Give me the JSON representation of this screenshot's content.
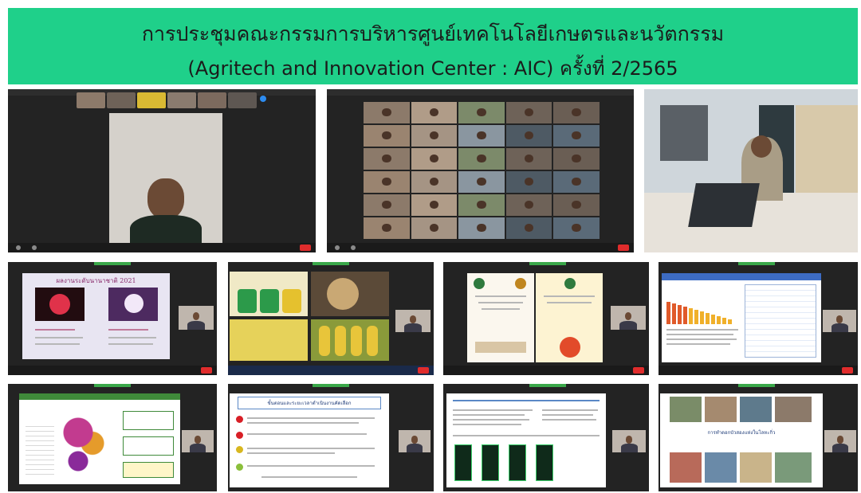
{
  "header": {
    "title_line1": "การประชุมคณะกรรมการบริหารศูนย์เทคโนโลยีเกษตรและนวัตกรรม",
    "title_line2": "(Agritech and Innovation Center : AIC) ครั้งที่ 2/2565",
    "background_color": "#1fd08a"
  },
  "slides": {
    "awards_title": "ผลงานระดับนานาชาติ 2021",
    "procedure_title": "ขั้นตอนและระยะเวลาดำเนินงานคัดเลือก",
    "training_title": "การทำดอกบัวสองแห่งในโลหะกิ่ว"
  },
  "icons": [
    "participant-camera-icon",
    "end-call-icon",
    "mic-icon",
    "video-icon"
  ]
}
